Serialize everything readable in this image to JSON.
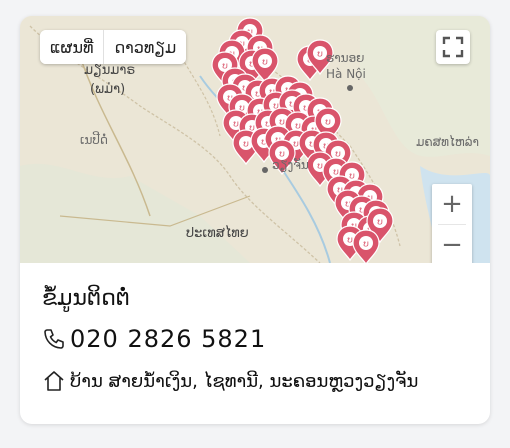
{
  "map": {
    "type_options": [
      "ແຜນທີ່",
      "ດາວທຽມ"
    ],
    "selected_type": "ແຜນທີ່",
    "fullscreen_icon": "fullscreen-icon",
    "zoom_in_label": "+",
    "zoom_out_label": "−",
    "place_labels": {
      "myanmar": "ມຽນມາຣ",
      "myanmar_paren": "(ພມ່າ)",
      "hanoi_lao": "ຮານອຍ",
      "hanoi": "Hà Nội",
      "naypyidaw": "ເນປີດໍ່",
      "gulf": "ມຄສທໄຫລ່າ",
      "thailand": "ປະເທສໄທຍ",
      "vientiane": "ວຽງຈັນ"
    },
    "marker_glyph": "ບ",
    "marker_color": "#d9546b"
  },
  "contact": {
    "title": "ຂໍ້ມູນຕິດຕໍ່",
    "phone": "020 2826 5821",
    "phone_icon": "phone-icon",
    "address": "ບ້ານ ສາຍນ້ຳເງິນ, ໄຊທານີ, ນະຄອນຫຼວງວຽງຈັນ",
    "address_icon": "home-icon"
  }
}
